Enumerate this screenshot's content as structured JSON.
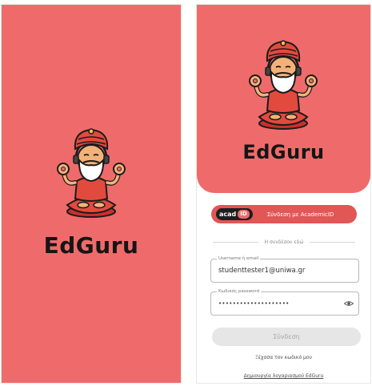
{
  "splash": {
    "brand": "EdGuru",
    "background_color": "#ef6b6b"
  },
  "login": {
    "brand": "EdGuru",
    "academid": {
      "logo_text": "acad",
      "logo_badge": "ID",
      "label": "Σύνδεση με AcademicID"
    },
    "divider_text": "Η συνδέσου εδώ",
    "username": {
      "label": "Username ή email",
      "value": "studenttester1@uniwa.gr"
    },
    "password": {
      "label": "Κωδικός password",
      "value": "••••••••••••••••••••",
      "toggle_icon": "eye-icon"
    },
    "submit_label": "Σύνδεση",
    "forgot_link": "Ξέχασα τον κωδικό μου",
    "create_link": "Δημιουργία λογαριασμού EdGuru"
  },
  "colors": {
    "brand_red": "#ef6b6b",
    "button_red": "#e25656",
    "disabled_button": "#e6e6e6"
  },
  "mascot": {
    "icon": "guru-mascot-icon"
  }
}
